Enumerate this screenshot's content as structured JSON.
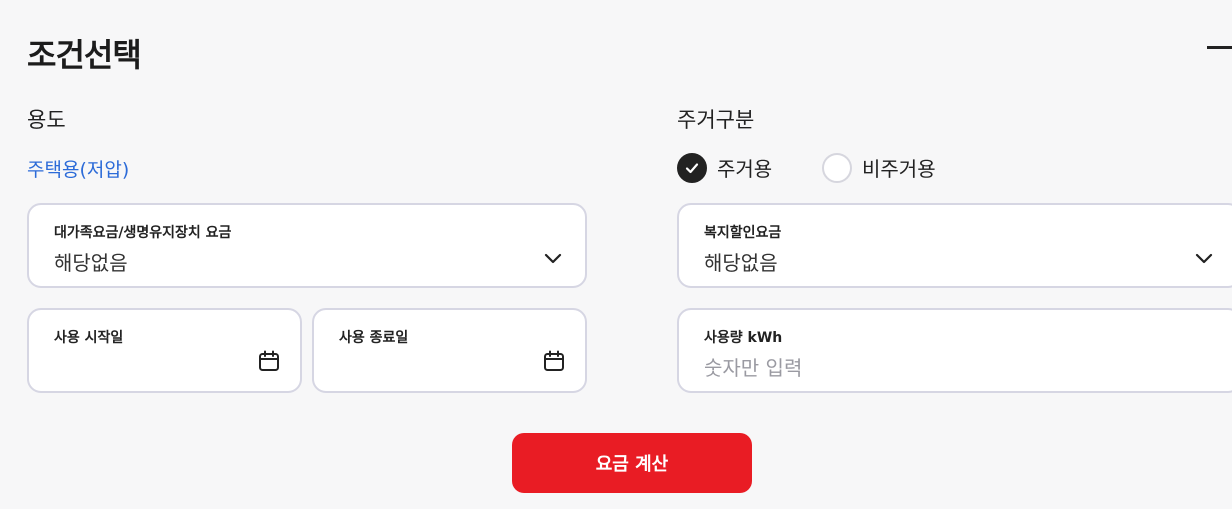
{
  "section": {
    "title": "조건선택"
  },
  "usage": {
    "label": "용도",
    "selected": "주택용(저압)",
    "large_family_select": {
      "caption": "대가족요금/생명유지장치 요금",
      "value": "해당없음"
    },
    "start_date": {
      "caption": "사용 시작일"
    },
    "end_date": {
      "caption": "사용 종료일"
    }
  },
  "residence": {
    "label": "주거구분",
    "options": [
      {
        "label": "주거용",
        "checked": true
      },
      {
        "label": "비주거용",
        "checked": false
      }
    ],
    "welfare_select": {
      "caption": "복지할인요금",
      "value": "해당없음"
    },
    "usage_input": {
      "caption": "사용량 kWh",
      "placeholder": "숫자만 입력"
    }
  },
  "actions": {
    "calculate_label": "요금 계산"
  },
  "colors": {
    "accent": "#e91c24",
    "link": "#2c6bd8"
  }
}
